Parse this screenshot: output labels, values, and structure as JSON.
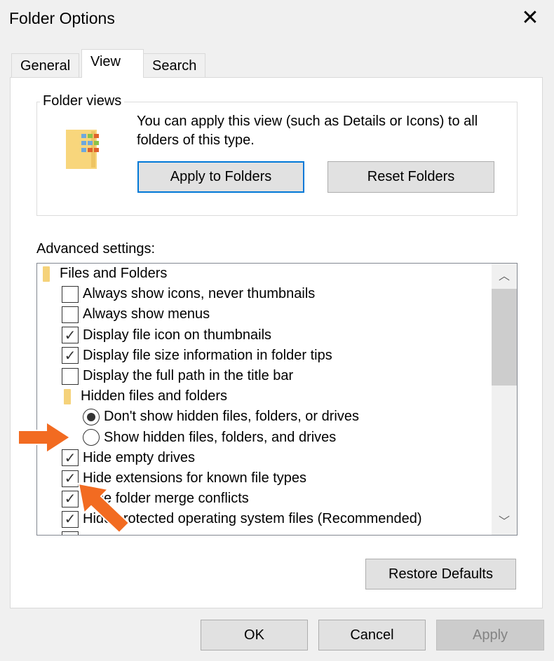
{
  "window": {
    "title": "Folder Options",
    "close_icon": "close-icon"
  },
  "tabs": [
    {
      "label": "General",
      "active": false
    },
    {
      "label": "View",
      "active": true
    },
    {
      "label": "Search",
      "active": false
    }
  ],
  "folder_views": {
    "label": "Folder views",
    "description": "You can apply this view (such as Details or Icons) to all folders of this type.",
    "apply_label": "Apply to Folders",
    "reset_label": "Reset Folders"
  },
  "advanced": {
    "label": "Advanced settings:",
    "items": [
      {
        "type": "folder",
        "level": 0,
        "label": "Files and Folders"
      },
      {
        "type": "checkbox",
        "checked": false,
        "label": "Always show icons, never thumbnails"
      },
      {
        "type": "checkbox",
        "checked": false,
        "label": "Always show menus"
      },
      {
        "type": "checkbox",
        "checked": true,
        "label": "Display file icon on thumbnails"
      },
      {
        "type": "checkbox",
        "checked": true,
        "label": "Display file size information in folder tips"
      },
      {
        "type": "checkbox",
        "checked": false,
        "label": "Display the full path in the title bar"
      },
      {
        "type": "folder",
        "level": 1,
        "label": "Hidden files and folders"
      },
      {
        "type": "radio",
        "checked": true,
        "label": "Don't show hidden files, folders, or drives"
      },
      {
        "type": "radio",
        "checked": false,
        "label": "Show hidden files, folders, and drives"
      },
      {
        "type": "checkbox",
        "checked": true,
        "label": "Hide empty drives"
      },
      {
        "type": "checkbox",
        "checked": true,
        "label": "Hide extensions for known file types"
      },
      {
        "type": "checkbox",
        "checked": true,
        "label": "Hide folder merge conflicts"
      },
      {
        "type": "checkbox",
        "checked": true,
        "label": "Hide protected operating system files (Recommended)"
      },
      {
        "type": "checkbox",
        "checked": true,
        "label": ""
      }
    ]
  },
  "buttons": {
    "restore_defaults": "Restore Defaults",
    "ok": "OK",
    "cancel": "Cancel",
    "apply": "Apply"
  },
  "annotation_color": "#f26b21"
}
